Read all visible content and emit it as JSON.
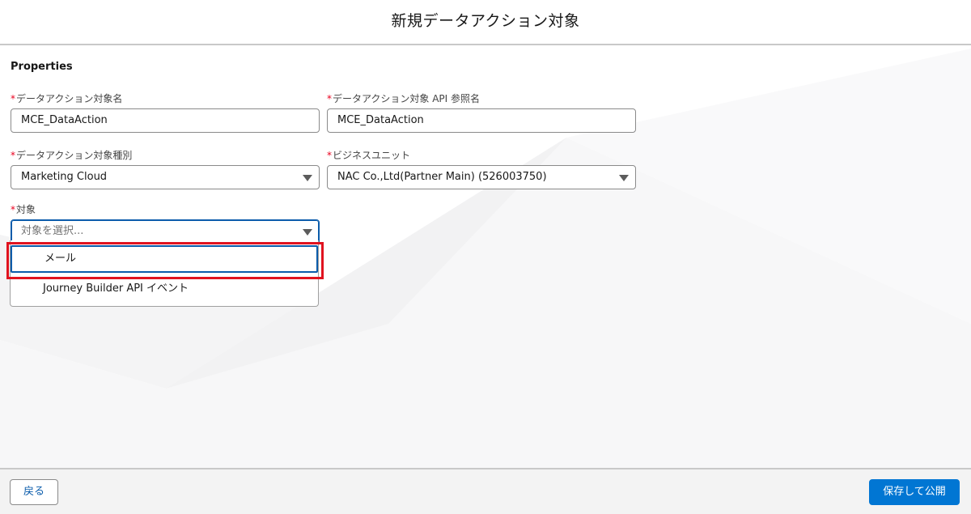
{
  "header": {
    "title": "新規データアクション対象"
  },
  "section": {
    "title": "Properties"
  },
  "fields": {
    "name": {
      "required_mark": "*",
      "label": "データアクション対象名",
      "value": "MCE_DataAction"
    },
    "api_name": {
      "required_mark": "*",
      "label": "データアクション対象 API 参照名",
      "value": "MCE_DataAction"
    },
    "type": {
      "required_mark": "*",
      "label": "データアクション対象種別",
      "value": "Marketing Cloud"
    },
    "business_unit": {
      "required_mark": "*",
      "label": "ビジネスユニット",
      "value": "NAC Co.,Ltd(Partner Main) (526003750)"
    },
    "target": {
      "required_mark": "*",
      "label": "対象",
      "placeholder": "対象を選択..."
    }
  },
  "dropdown": {
    "options": [
      {
        "label": "メール",
        "state": "focused"
      },
      {
        "label": "Journey Builder API イベント",
        "state": "default"
      }
    ]
  },
  "footer": {
    "back_label": "戻る",
    "save_label": "保存して公開"
  },
  "colors": {
    "accent": "#0176d3",
    "focus_border": "#0b5cab",
    "required": "#ea001e",
    "annotation": "#e0131f",
    "footer_bg": "#f3f3f3"
  },
  "icons": {
    "select_caret": "caret-down-icon"
  }
}
